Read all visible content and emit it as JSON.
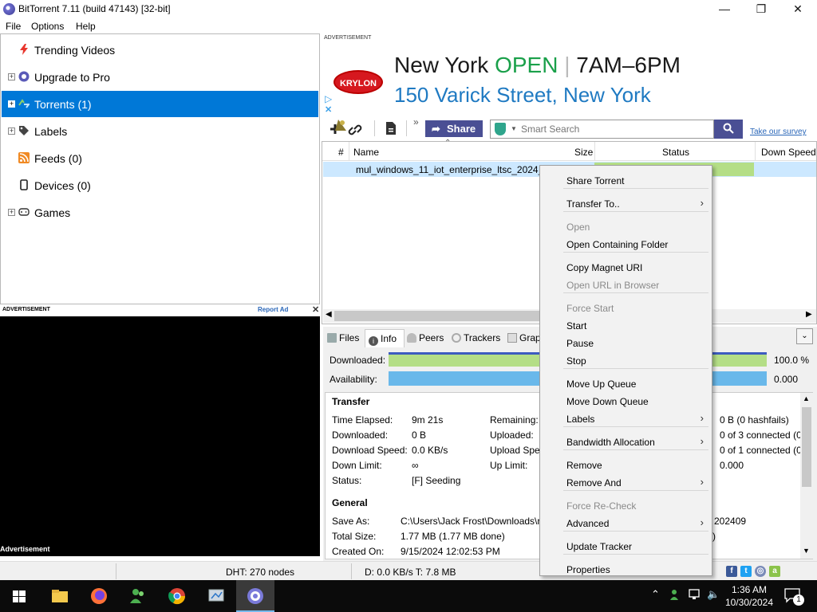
{
  "window": {
    "title": "BitTorrent 7.11  (build 47143) [32-bit]",
    "minimize": "—",
    "maximize": "❐",
    "close": "✕"
  },
  "menubar": {
    "file": "File",
    "options": "Options",
    "help": "Help"
  },
  "sidebar": {
    "items": [
      {
        "label": "Trending Videos",
        "icon": "lightning-icon",
        "expander": ""
      },
      {
        "label": "Upgrade to Pro",
        "icon": "bittorrent-logo-icon",
        "expander": "+"
      },
      {
        "label": "Torrents (1)",
        "icon": "torrents-icon",
        "expander": "+",
        "selected": true
      },
      {
        "label": "Labels",
        "icon": "tag-icon",
        "expander": "+"
      },
      {
        "label": "Feeds (0)",
        "icon": "rss-icon",
        "expander": ""
      },
      {
        "label": "Devices (0)",
        "icon": "device-icon",
        "expander": ""
      },
      {
        "label": "Games",
        "icon": "gamepad-icon",
        "expander": "+"
      }
    ]
  },
  "left_ad": {
    "header": "ADVERTISEMENT",
    "report": "Report Ad",
    "close": "✕",
    "footer": "Advertisement"
  },
  "top_ad": {
    "label": "ADVERTISEMENT",
    "brand": "KRYLON",
    "line1_city": "New York",
    "line1_open": "OPEN",
    "line1_sep": "|",
    "line1_hours": "7AM–6PM",
    "line2": "150 Varick Street, New York"
  },
  "toolbar": {
    "share_label": "Share",
    "more": "»",
    "search_placeholder": "Smart Search",
    "survey": "Take our survey"
  },
  "list": {
    "headers": {
      "num": "#",
      "name": "Name",
      "size": "Size",
      "status": "Status",
      "down_speed": "Down Speed"
    },
    "rows": [
      {
        "name": "mul_windows_11_iot_enterprise_ltsc_2024_2"
      }
    ]
  },
  "tabs": [
    {
      "label": "Files",
      "icon": "files-icon"
    },
    {
      "label": "Info",
      "icon": "info-icon",
      "active": true
    },
    {
      "label": "Peers",
      "icon": "peers-icon"
    },
    {
      "label": "Trackers",
      "icon": "trackers-icon"
    },
    {
      "label": "Grap",
      "icon": "graph-icon"
    }
  ],
  "tabs_expand": "⌄",
  "info": {
    "downloaded_label": "Downloaded:",
    "downloaded_value": "100.0 %",
    "downloaded_fraction": 1.0,
    "availability_label": "Availability:",
    "availability_value": "0.000",
    "transfer_title": "Transfer",
    "transfer": {
      "time_elapsed_label": "Time Elapsed:",
      "time_elapsed": "9m 21s",
      "downloaded_label": "Downloaded:",
      "downloaded": "0 B",
      "download_speed_label": "Download Speed:",
      "download_speed": "0.0 KB/s",
      "down_limit_label": "Down Limit:",
      "down_limit": "∞",
      "status_label": "Status:",
      "status": "[F] Seeding",
      "remaining_label": "Remaining:",
      "uploaded_label": "Uploaded:",
      "upload_speed_label": "Upload Spe",
      "up_limit_label": "Up Limit:",
      "wasted": "0 B (0 hashfails)",
      "seeds": "0 of 3 connected (0",
      "peers": "0 of 1 connected (0",
      "share_ratio": "0.000"
    },
    "general_title": "General",
    "general": {
      "save_as_label": "Save As:",
      "save_as": "C:\\Users\\Jack Frost\\Downloads\\r",
      "total_size_label": "Total Size:",
      "total_size": "1.77 MB (1.77 MB done)",
      "created_on_label": "Created On:",
      "created_on": "9/15/2024 12:02:53 PM",
      "right_1": "202409",
      "right_2": ")"
    }
  },
  "statusbar": {
    "dht": "DHT: 270 nodes",
    "transfer": "D: 0.0 KB/s T: 7.8 MB"
  },
  "context_menu": {
    "items": [
      {
        "label": "Share Torrent",
        "enabled": true,
        "submenu": false
      },
      {
        "sep": true
      },
      {
        "label": "Transfer To..",
        "enabled": true,
        "submenu": true
      },
      {
        "sep": true
      },
      {
        "label": "Open",
        "enabled": false,
        "submenu": false
      },
      {
        "label": "Open Containing Folder",
        "enabled": true,
        "submenu": false
      },
      {
        "sep": true
      },
      {
        "label": "Copy Magnet URI",
        "enabled": true,
        "submenu": false
      },
      {
        "label": "Open URL in Browser",
        "enabled": false,
        "submenu": false
      },
      {
        "sep": true
      },
      {
        "label": "Force Start",
        "enabled": false,
        "submenu": false
      },
      {
        "label": "Start",
        "enabled": true,
        "submenu": false
      },
      {
        "label": "Pause",
        "enabled": true,
        "submenu": false
      },
      {
        "label": "Stop",
        "enabled": true,
        "submenu": false
      },
      {
        "sep": true
      },
      {
        "label": "Move Up Queue",
        "enabled": true,
        "submenu": false
      },
      {
        "label": "Move Down Queue",
        "enabled": true,
        "submenu": false
      },
      {
        "label": "Labels",
        "enabled": true,
        "submenu": true
      },
      {
        "sep": true
      },
      {
        "label": "Bandwidth Allocation",
        "enabled": true,
        "submenu": true
      },
      {
        "sep": true
      },
      {
        "label": "Remove",
        "enabled": true,
        "submenu": false
      },
      {
        "label": "Remove And",
        "enabled": true,
        "submenu": true
      },
      {
        "sep": true
      },
      {
        "label": "Force Re-Check",
        "enabled": false,
        "submenu": false
      },
      {
        "label": "Advanced",
        "enabled": true,
        "submenu": true
      },
      {
        "sep": true
      },
      {
        "label": "Update Tracker",
        "enabled": true,
        "submenu": false
      },
      {
        "sep": true
      },
      {
        "label": "Properties",
        "enabled": true,
        "submenu": false
      }
    ]
  },
  "taskbar": {
    "time": "1:36 AM",
    "date": "10/30/2024",
    "notification_count": "1",
    "apps": [
      "start-button",
      "file-explorer-icon",
      "firefox-icon",
      "people-icon",
      "chrome-icon",
      "control-panel-icon",
      "bittorrent-taskbar-icon"
    ]
  },
  "colors": {
    "accent": "#0078d7",
    "progress_green": "#b4de86",
    "availability_blue": "#69b8ea",
    "share_purple": "#4a4f94"
  }
}
